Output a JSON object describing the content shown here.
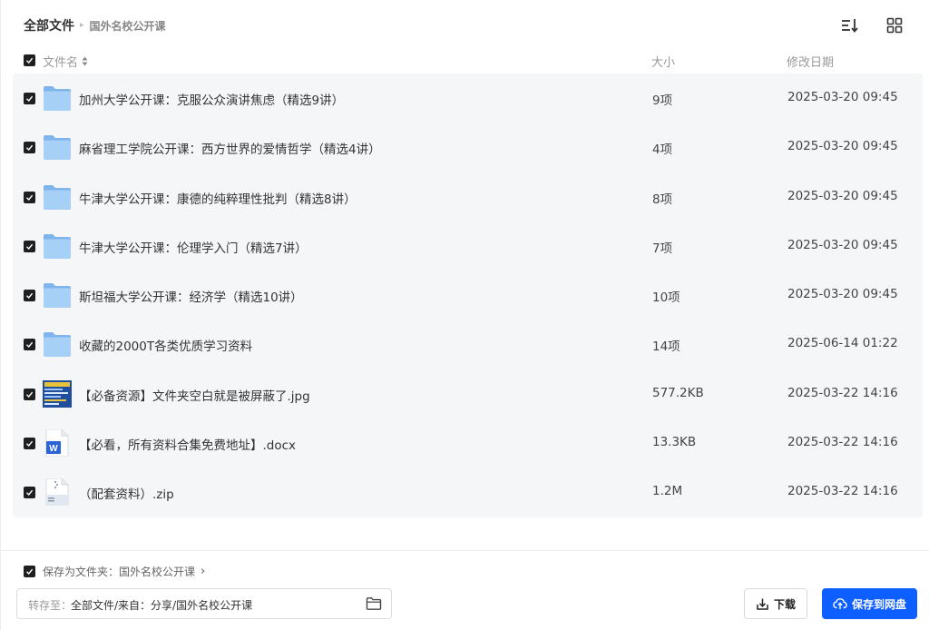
{
  "breadcrumb": {
    "root": "全部文件",
    "current": "国外名校公开课"
  },
  "toolbar": {
    "sort_icon": "sort-icon",
    "grid_icon": "grid-view-icon"
  },
  "columns": {
    "name": "文件名",
    "size": "大小",
    "date": "修改日期"
  },
  "files": [
    {
      "name": "加州大学公开课：克服公众演讲焦虑（精选9讲）",
      "size": "9项",
      "date": "2025-03-20 09:45",
      "type": "folder"
    },
    {
      "name": "麻省理工学院公开课：西方世界的爱情哲学（精选4讲）",
      "size": "4项",
      "date": "2025-03-20 09:45",
      "type": "folder"
    },
    {
      "name": "牛津大学公开课：康德的纯粹理性批判（精选8讲）",
      "size": "8项",
      "date": "2025-03-20 09:45",
      "type": "folder"
    },
    {
      "name": "牛津大学公开课：伦理学入门（精选7讲）",
      "size": "7项",
      "date": "2025-03-20 09:45",
      "type": "folder"
    },
    {
      "name": "斯坦福大学公开课：经济学（精选10讲）",
      "size": "10项",
      "date": "2025-03-20 09:45",
      "type": "folder"
    },
    {
      "name": "收藏的2000T各类优质学习资料",
      "size": "14项",
      "date": "2025-06-14 01:22",
      "type": "folder"
    },
    {
      "name": "【必备资源】文件夹空白就是被屏蔽了.jpg",
      "size": "577.2KB",
      "date": "2025-03-22 14:16",
      "type": "image"
    },
    {
      "name": "【必看，所有资料合集免费地址】.docx",
      "size": "13.3KB",
      "date": "2025-03-22 14:16",
      "type": "word"
    },
    {
      "name": "（配套资料）.zip",
      "size": "1.2M",
      "date": "2025-03-22 14:16",
      "type": "zip"
    }
  ],
  "footer": {
    "save_as_folder_label": "保存为文件夹：国外名校公开课",
    "path_label": "转存至：",
    "path_value": "全部文件/来自：分享/国外名校公开课",
    "download_label": "下载",
    "save_label": "保存到网盘"
  },
  "colors": {
    "accent": "#0d5fff",
    "list_bg": "#f5f6f8",
    "folder": "#8fc1f2"
  }
}
